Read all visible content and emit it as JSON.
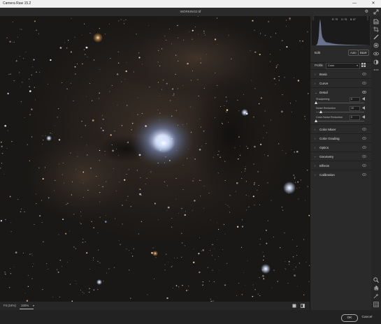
{
  "os_window": {
    "app_title": "Camera Raw 15.2",
    "minimize": "—",
    "close": "✕"
  },
  "document": {
    "filename": "WORKING2.tif"
  },
  "histogram": {
    "readouts": [
      "R: 79",
      "G: 75",
      "B: 67"
    ]
  },
  "panel": {
    "edit_label": "Edit",
    "auto_label": "Auto",
    "bw_label": "B&W",
    "profile_label": "Profile",
    "profile_value": "Color",
    "sections": {
      "basic": "Basic",
      "curve": "Curve",
      "detail": "Detail",
      "color_mixer": "Color Mixer",
      "color_grading": "Color Grading",
      "optics": "Optics",
      "geometry": "Geometry",
      "effects": "Effects",
      "calibration": "Calibration"
    },
    "detail_sliders": [
      {
        "label": "Sharpening",
        "value": "0",
        "fraction": 0.0
      },
      {
        "label": "Noise Reduction",
        "value": "10",
        "fraction": 0.1
      },
      {
        "label": "Color Noise Reduction",
        "value": "0",
        "fraction": 0.0
      }
    ]
  },
  "status": {
    "fit_label": "Fit (24%)",
    "zoom_value": "100%"
  },
  "footer": {
    "ok_label": "OK",
    "cancel_label": "Cancel"
  },
  "tools": [
    "edit-icon",
    "crop-icon",
    "heal-icon",
    "mask-icon",
    "redeye-icon",
    "presets-icon",
    "more-icon",
    "zoom-icon",
    "hand-icon",
    "sampler-icon",
    "grid-overlay-icon"
  ],
  "colors": {
    "accent": "#2680eb",
    "panel_bg": "#2a2a2a",
    "image_bg": "#161514"
  }
}
